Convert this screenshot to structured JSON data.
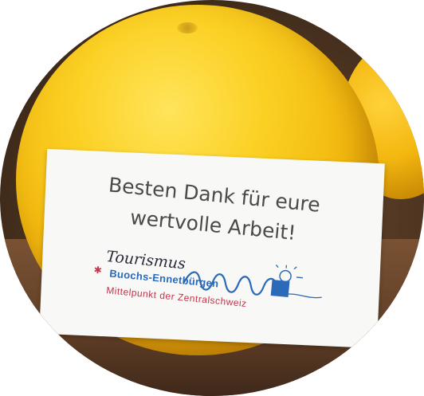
{
  "card": {
    "line1": "Besten Dank für eure",
    "line2": "wertvolle Arbeit!"
  },
  "logo": {
    "brand": "Tourismus",
    "place": "Buochs-Ennetbürgen",
    "tagline": "Mittelpunkt der Zentralschweiz"
  },
  "colors": {
    "orange": "#f2b70d",
    "card": "#f8f8f6",
    "text": "#4a4a4a",
    "logo_blue": "#2a6ab8",
    "logo_red": "#c8324a",
    "table": "#5e3d25"
  }
}
